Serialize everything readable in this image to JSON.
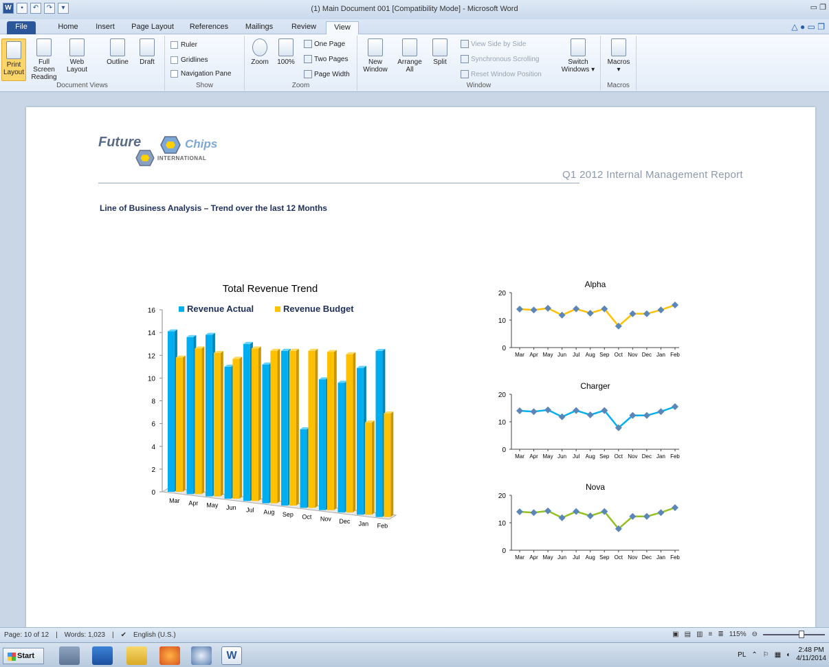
{
  "window": {
    "title": "(1) Main Document 001 [Compatibility Mode] - Microsoft Word"
  },
  "tabs": [
    {
      "label": "File"
    },
    {
      "label": "Home"
    },
    {
      "label": "Insert"
    },
    {
      "label": "Page Layout"
    },
    {
      "label": "References"
    },
    {
      "label": "Mailings"
    },
    {
      "label": "Review"
    },
    {
      "label": "View"
    }
  ],
  "ribbon": {
    "document_views": {
      "label": "Document Views",
      "buttons": [
        "Print Layout",
        "Full Screen Reading",
        "Web Layout",
        "Outline",
        "Draft"
      ]
    },
    "show": {
      "label": "Show",
      "items": [
        "Ruler",
        "Gridlines",
        "Navigation Pane"
      ]
    },
    "zoom": {
      "label": "Zoom",
      "zoom": "Zoom",
      "hundred": "100%",
      "one_page": "One Page",
      "two_pages": "Two Pages",
      "page_width": "Page Width"
    },
    "window": {
      "label": "Window",
      "new_window": "New Window",
      "arrange_all": "Arrange All",
      "split": "Split",
      "view_side_by_side": "View Side by Side",
      "sync_scrolling": "Synchronous Scrolling",
      "reset_position": "Reset Window Position",
      "switch_windows": "Switch Windows"
    },
    "macros": {
      "label": "Macros",
      "button": "Macros"
    }
  },
  "document": {
    "logo_word1": "Future",
    "logo_word2": "Chips",
    "logo_sub": "INTERNATIONAL",
    "report_title": "Q1 2012 Internal Management  Report",
    "section_heading": "Line of Business Analysis  – Trend over the last 12 Months"
  },
  "chart_data": [
    {
      "type": "bar",
      "title": "Total Revenue Trend",
      "categories": [
        "Mar",
        "Apr",
        "May",
        "Jun",
        "Jul",
        "Aug",
        "Sep",
        "Oct",
        "Nov",
        "Dec",
        "Jan",
        "Feb"
      ],
      "series": [
        {
          "name": "Revenue Actual",
          "color": "#00aeef",
          "values": [
            14.1,
            13.8,
            14.2,
            11.6,
            13.8,
            12.2,
            13.6,
            6.9,
            11.5,
            11.4,
            12.9,
            14.6
          ]
        },
        {
          "name": "Revenue Budget",
          "color": "#ffc000",
          "values": [
            11.8,
            12.8,
            12.6,
            12.3,
            13.4,
            13.4,
            13.6,
            13.8,
            13.9,
            13.9,
            8.1,
            9.1
          ]
        }
      ],
      "ylim": [
        0,
        16
      ],
      "yticks": [
        0,
        2,
        4,
        6,
        8,
        10,
        12,
        14,
        16
      ],
      "legend": "top"
    },
    {
      "type": "line",
      "title": "Alpha",
      "categories": [
        "Mar",
        "Apr",
        "May",
        "Jun",
        "Jul",
        "Aug",
        "Sep",
        "Oct",
        "Nov",
        "Dec",
        "Jan",
        "Feb"
      ],
      "series": [
        {
          "color": "#ffc000",
          "values": [
            14,
            13.7,
            14.3,
            11.8,
            14.1,
            12.5,
            14.1,
            7.8,
            12.3,
            12.3,
            13.7,
            15.5
          ]
        }
      ],
      "ylim": [
        0,
        20
      ],
      "yticks": [
        0,
        10,
        20
      ]
    },
    {
      "type": "line",
      "title": "Charger",
      "categories": [
        "Mar",
        "Apr",
        "May",
        "Jun",
        "Jul",
        "Aug",
        "Sep",
        "Oct",
        "Nov",
        "Dec",
        "Jan",
        "Feb"
      ],
      "series": [
        {
          "color": "#00b0f0",
          "values": [
            14,
            13.7,
            14.3,
            11.8,
            14.1,
            12.5,
            14.1,
            7.8,
            12.3,
            12.3,
            13.7,
            15.5
          ]
        }
      ],
      "ylim": [
        0,
        20
      ],
      "yticks": [
        0,
        10,
        20
      ]
    },
    {
      "type": "line",
      "title": "Nova",
      "categories": [
        "Mar",
        "Apr",
        "May",
        "Jun",
        "Jul",
        "Aug",
        "Sep",
        "Oct",
        "Nov",
        "Dec",
        "Jan",
        "Feb"
      ],
      "series": [
        {
          "color": "#92c020",
          "values": [
            14,
            13.7,
            14.3,
            11.8,
            14.1,
            12.5,
            14.1,
            7.8,
            12.3,
            12.3,
            13.7,
            15.5
          ]
        }
      ],
      "ylim": [
        0,
        20
      ],
      "yticks": [
        0,
        10,
        20
      ]
    }
  ],
  "statusbar": {
    "page": "Page: 10 of 12",
    "words": "Words: 1,023",
    "language": "English (U.S.)",
    "zoom": "115%"
  },
  "taskbar": {
    "start": "Start",
    "lang": "PL",
    "time": "2:48 PM",
    "date": "4/11/2014"
  }
}
